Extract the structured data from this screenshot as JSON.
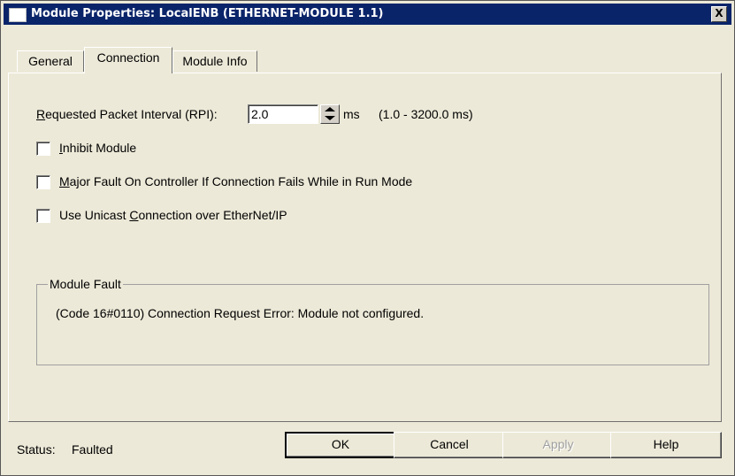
{
  "window": {
    "title": "Module Properties: LocalENB (ETHERNET-MODULE 1.1)",
    "close_label": "X"
  },
  "tabs": [
    {
      "label": "General"
    },
    {
      "label": "Connection"
    },
    {
      "label": "Module Info"
    }
  ],
  "rpi": {
    "label_prefix": "R",
    "label_rest": "equested Packet Interval (RPI):",
    "value": "2.0",
    "unit": "ms",
    "range": "(1.0 - 3200.0 ms)"
  },
  "checkboxes": {
    "inhibit": {
      "ul": "I",
      "rest": "nhibit Module",
      "checked": false
    },
    "major_fault": {
      "ul": "M",
      "rest": "ajor Fault On Controller If Connection Fails While in Run Mode",
      "checked": false
    },
    "unicast": {
      "pre": "Use Unicast ",
      "ul": "C",
      "rest": "onnection over EtherNet/IP",
      "checked": false
    }
  },
  "module_fault": {
    "title": "Module Fault",
    "message": "(Code 16#0110) Connection Request Error: Module not configured."
  },
  "status": {
    "label": "Status:",
    "value": "Faulted"
  },
  "buttons": {
    "ok": "OK",
    "cancel": "Cancel",
    "apply": "Apply",
    "help": "Help"
  }
}
